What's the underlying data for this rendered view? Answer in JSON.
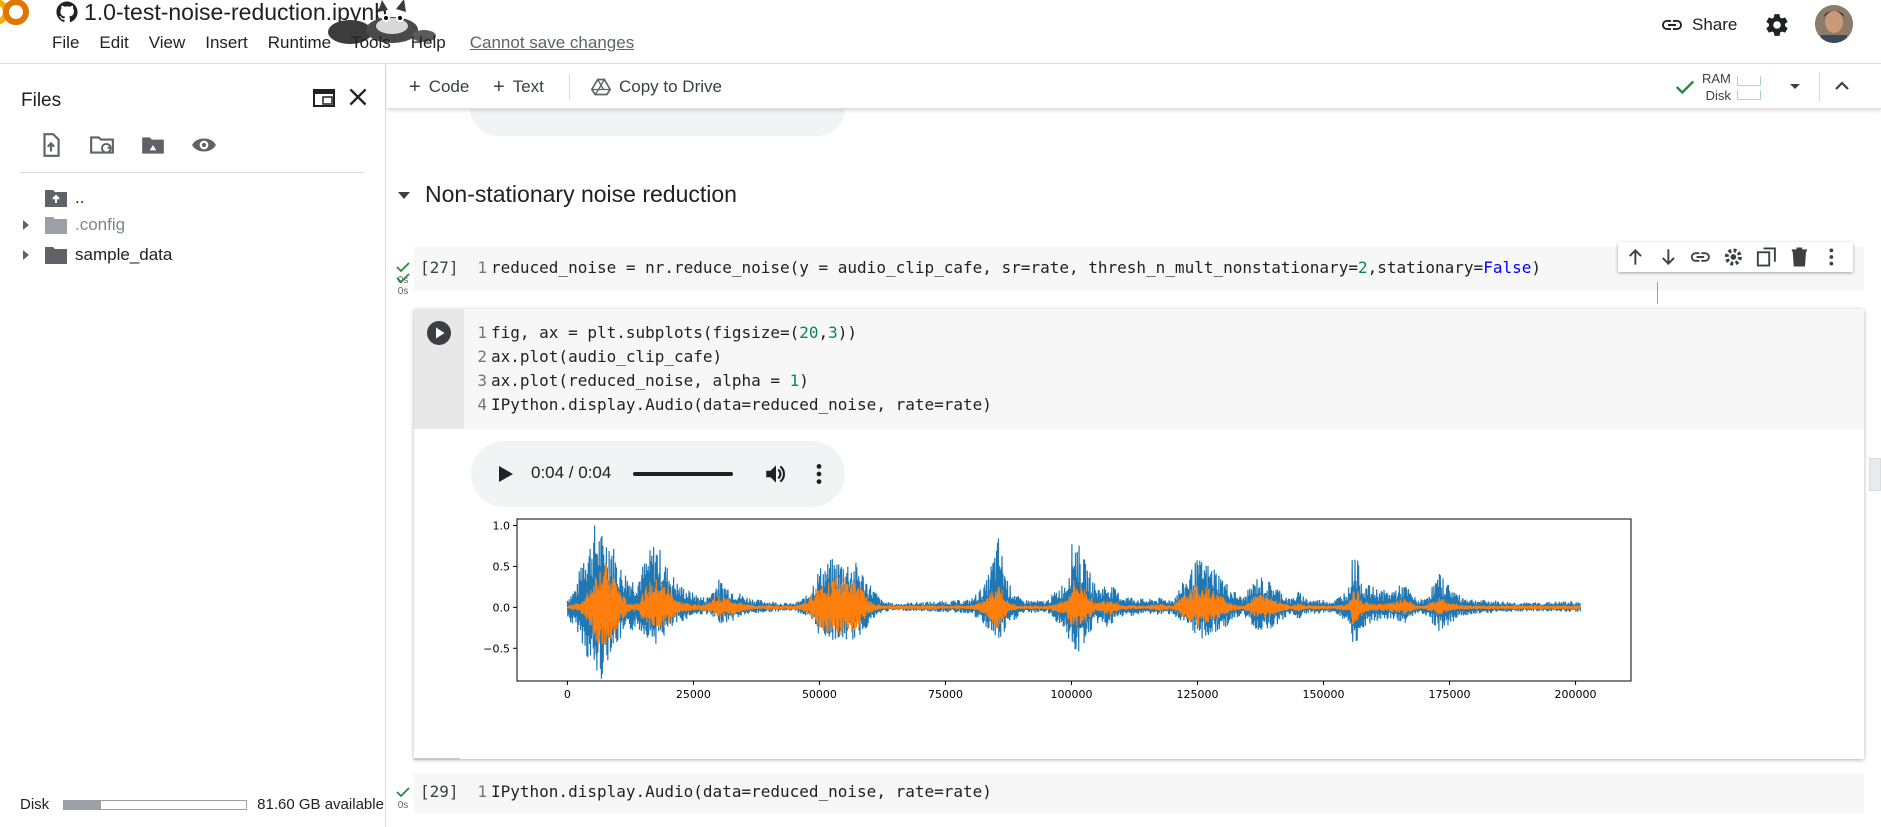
{
  "header": {
    "notebook_title": "1.0-test-noise-reduction.ipynb",
    "menu": [
      "File",
      "Edit",
      "View",
      "Insert",
      "Runtime",
      "Tools",
      "Help"
    ],
    "save_status": "Cannot save changes",
    "share_label": "Share"
  },
  "sidebar": {
    "title": "Files",
    "tree": [
      {
        "label": "..",
        "kind": "parent"
      },
      {
        "label": ".config",
        "kind": "folder"
      },
      {
        "label": "sample_data",
        "kind": "folder"
      }
    ],
    "disk_label": "Disk",
    "disk_available": "81.60 GB available",
    "disk_used_fraction": 0.2
  },
  "toolbar": {
    "code_label": "Code",
    "text_label": "Text",
    "copy_to_drive_label": "Copy to Drive",
    "ram_label": "RAM",
    "disk_label": "Disk"
  },
  "notebook": {
    "section_title": "Non-stationary noise reduction",
    "cells": [
      {
        "exec_count": "[27]",
        "time": "0s",
        "lines": [
          [
            {
              "t": "reduced_noise = nr.reduce_noise(y = audio_clip_cafe, sr=rate, thresh_n_mult_nonstationary="
            },
            {
              "t": "2",
              "c": "num"
            },
            {
              "t": ",stationary="
            },
            {
              "t": "False",
              "c": "kw"
            },
            {
              "t": ")"
            }
          ]
        ]
      },
      {
        "exec_count": "",
        "time": "0s",
        "lines": [
          [
            {
              "t": "fig, ax = plt.subplots(figsize=("
            },
            {
              "t": "20",
              "c": "num"
            },
            {
              "t": ","
            },
            {
              "t": "3",
              "c": "num"
            },
            {
              "t": "))"
            }
          ],
          [
            {
              "t": "ax.plot(audio_clip_cafe)"
            }
          ],
          [
            {
              "t": "ax.plot(reduced_noise, alpha = "
            },
            {
              "t": "1",
              "c": "num"
            },
            {
              "t": ")"
            }
          ],
          [
            {
              "t": "IPython.display.Audio(data=reduced_noise, rate=rate)"
            }
          ]
        ],
        "audio_time": "0:04 / 0:04"
      },
      {
        "exec_count": "[29]",
        "time": "0s",
        "lines": [
          [
            {
              "t": "IPython.display.Audio(data=reduced_noise, rate=rate)"
            }
          ]
        ]
      }
    ]
  },
  "colors": {
    "original_series": "#1f77b4",
    "reduced_series": "#ff7f0e",
    "check_green": "#1e8e3e"
  },
  "chart_data": {
    "type": "line",
    "title": "",
    "xlabel": "",
    "ylabel": "",
    "xlim": [
      -10000,
      211000
    ],
    "ylim": [
      -0.9,
      1.08
    ],
    "xticks": [
      0,
      25000,
      50000,
      75000,
      100000,
      125000,
      150000,
      175000,
      200000
    ],
    "yticks": [
      1.0,
      0.5,
      0.0,
      -0.5
    ],
    "ytick_labels": [
      "1.0",
      "0.5",
      "0.0",
      "−0.5"
    ],
    "grid": false,
    "legend": "none",
    "series": [
      {
        "color": "#1f77b4",
        "envelope": {
          "x": [
            0,
            2000,
            3000,
            4500,
            5500,
            7000,
            8500,
            10000,
            12000,
            13500,
            15500,
            17500,
            19500,
            22000,
            25000,
            27500,
            30000,
            32500,
            35000,
            37500,
            40000,
            42500,
            45000,
            47500,
            50000,
            52500,
            55000,
            57500,
            60000,
            62500,
            65000,
            70000,
            75000,
            80000,
            83000,
            85500,
            87500,
            90000,
            95000,
            99000,
            100500,
            102500,
            105000,
            107500,
            110000,
            115000,
            117500,
            120000,
            125000,
            128500,
            131500,
            134000,
            137000,
            140000,
            143500,
            145000,
            147000,
            150000,
            152000,
            155000,
            156000,
            158000,
            160000,
            163000,
            166000,
            168500,
            170000,
            173000,
            177000,
            180000,
            185000,
            190000,
            195000,
            200000,
            201000
          ],
          "upper": [
            0.12,
            0.3,
            0.75,
            0.85,
            1.05,
            0.9,
            0.95,
            0.55,
            0.42,
            0.35,
            0.6,
            0.85,
            0.55,
            0.3,
            0.18,
            0.12,
            0.35,
            0.25,
            0.15,
            0.1,
            0.08,
            0.06,
            0.05,
            0.15,
            0.5,
            0.6,
            0.6,
            0.55,
            0.3,
            0.08,
            0.05,
            0.07,
            0.08,
            0.1,
            0.3,
            0.88,
            0.3,
            0.1,
            0.08,
            0.35,
            0.95,
            0.6,
            0.25,
            0.3,
            0.15,
            0.1,
            0.12,
            0.1,
            0.6,
            0.5,
            0.25,
            0.12,
            0.4,
            0.3,
            0.1,
            0.2,
            0.1,
            0.1,
            0.08,
            0.25,
            0.75,
            0.3,
            0.25,
            0.2,
            0.3,
            0.1,
            0.1,
            0.42,
            0.15,
            0.1,
            0.08,
            0.06,
            0.07,
            0.08,
            0.06
          ],
          "lower": [
            -0.15,
            -0.3,
            -0.45,
            -0.75,
            -0.85,
            -0.9,
            -0.55,
            -0.45,
            -0.35,
            -0.25,
            -0.35,
            -0.45,
            -0.35,
            -0.2,
            -0.1,
            -0.08,
            -0.2,
            -0.18,
            -0.1,
            -0.08,
            -0.06,
            -0.05,
            -0.04,
            -0.12,
            -0.35,
            -0.4,
            -0.42,
            -0.4,
            -0.2,
            -0.06,
            -0.04,
            -0.05,
            -0.06,
            -0.08,
            -0.25,
            -0.45,
            -0.25,
            -0.08,
            -0.06,
            -0.3,
            -0.7,
            -0.45,
            -0.2,
            -0.25,
            -0.12,
            -0.08,
            -0.1,
            -0.08,
            -0.4,
            -0.35,
            -0.2,
            -0.1,
            -0.3,
            -0.25,
            -0.08,
            -0.15,
            -0.08,
            -0.08,
            -0.06,
            -0.2,
            -0.65,
            -0.25,
            -0.2,
            -0.15,
            -0.2,
            -0.08,
            -0.08,
            -0.3,
            -0.12,
            -0.08,
            -0.06,
            -0.05,
            -0.05,
            -0.06,
            -0.05
          ]
        }
      },
      {
        "color": "#ff7f0e",
        "envelope": {
          "x": [
            0,
            2000,
            3500,
            4500,
            6000,
            7500,
            9000,
            10500,
            12000,
            14000,
            16000,
            18000,
            20000,
            22000,
            25000,
            27500,
            30000,
            32500,
            35000,
            37500,
            40000,
            42500,
            45000,
            47500,
            50000,
            52500,
            55000,
            57500,
            60000,
            62500,
            65000,
            70000,
            75000,
            80000,
            83000,
            85500,
            87500,
            90000,
            95000,
            99000,
            100500,
            102500,
            105000,
            107500,
            110000,
            115000,
            117500,
            120000,
            125000,
            128500,
            131500,
            134000,
            137000,
            140000,
            143500,
            145000,
            147000,
            150000,
            152000,
            155000,
            156000,
            158000,
            160000,
            163000,
            166000,
            168500,
            170000,
            173000,
            177000,
            180000,
            185000,
            190000,
            195000,
            200000,
            201000
          ],
          "upper": [
            0.02,
            0.06,
            0.12,
            0.25,
            0.5,
            0.55,
            0.45,
            0.2,
            0.06,
            0.06,
            0.3,
            0.35,
            0.25,
            0.08,
            0.04,
            0.05,
            0.15,
            0.1,
            0.05,
            0.02,
            0.03,
            0.02,
            0.02,
            0.08,
            0.3,
            0.38,
            0.38,
            0.3,
            0.08,
            0.02,
            0.01,
            0.01,
            0.02,
            0.02,
            0.1,
            0.32,
            0.06,
            0.02,
            0.02,
            0.1,
            0.35,
            0.25,
            0.05,
            0.12,
            0.03,
            0.02,
            0.05,
            0.02,
            0.3,
            0.2,
            0.06,
            0.02,
            0.18,
            0.12,
            0.02,
            0.06,
            0.02,
            0.02,
            0.02,
            0.05,
            0.28,
            0.08,
            0.05,
            0.05,
            0.12,
            0.02,
            0.02,
            0.12,
            0.03,
            0.02,
            0.02,
            0.01,
            0.01,
            0.01,
            0.01
          ],
          "lower": [
            -0.02,
            -0.05,
            -0.12,
            -0.25,
            -0.45,
            -0.5,
            -0.4,
            -0.2,
            -0.06,
            -0.06,
            -0.28,
            -0.3,
            -0.22,
            -0.07,
            -0.04,
            -0.05,
            -0.12,
            -0.1,
            -0.05,
            -0.02,
            -0.03,
            -0.02,
            -0.02,
            -0.08,
            -0.28,
            -0.35,
            -0.35,
            -0.28,
            -0.08,
            -0.02,
            -0.01,
            -0.01,
            -0.02,
            -0.02,
            -0.1,
            -0.3,
            -0.06,
            -0.02,
            -0.02,
            -0.1,
            -0.32,
            -0.22,
            -0.05,
            -0.1,
            -0.03,
            -0.02,
            -0.05,
            -0.02,
            -0.25,
            -0.18,
            -0.06,
            -0.02,
            -0.15,
            -0.1,
            -0.02,
            -0.05,
            -0.02,
            -0.02,
            -0.02,
            -0.05,
            -0.25,
            -0.07,
            -0.05,
            -0.05,
            -0.1,
            -0.02,
            -0.02,
            -0.1,
            -0.03,
            -0.02,
            -0.02,
            -0.01,
            -0.01,
            -0.01,
            -0.01
          ]
        }
      }
    ]
  }
}
